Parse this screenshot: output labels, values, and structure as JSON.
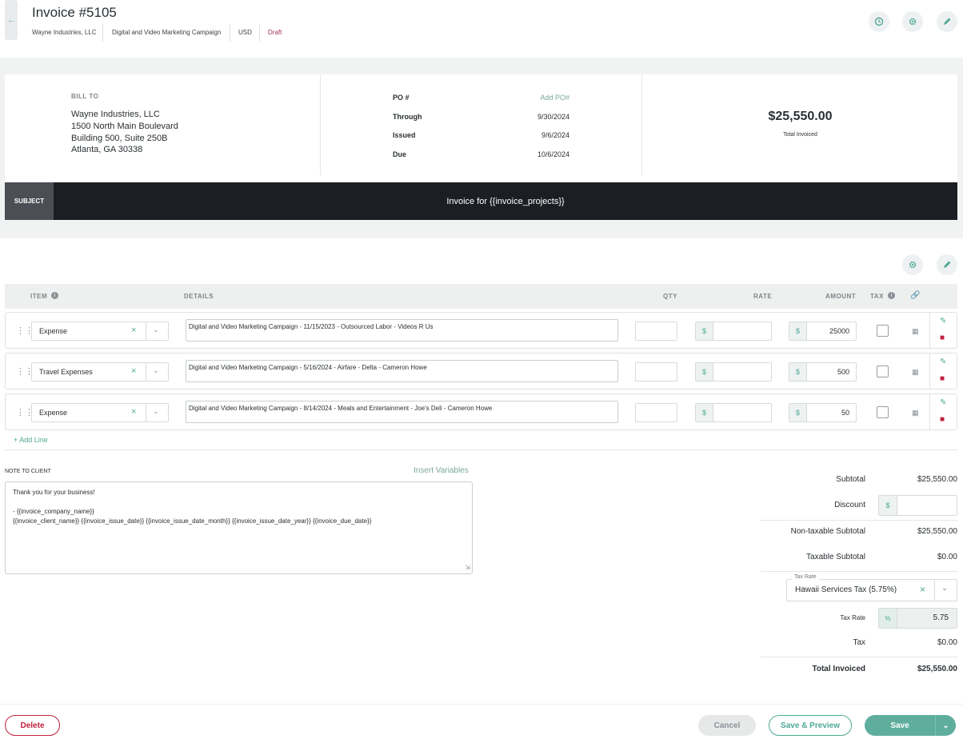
{
  "header": {
    "back_icon": "arrow-left-icon",
    "title": "Invoice #5105",
    "client": "Wayne Industries, LLC",
    "project": "Digital and Video Marketing Campaign",
    "currency": "USD",
    "status": "Draft",
    "status_color": "#a0344c",
    "accent_color": "#4fa896"
  },
  "bill_to": {
    "label": "BILL TO",
    "name": "Wayne Industries, LLC",
    "address1": "1500 North Main Boulevard",
    "address2": "Building 500, Suite 250B",
    "city": "Atlanta, GA 30338"
  },
  "po": {
    "po_label": "PO #",
    "po_placeholder": "Add PO#",
    "through_label": "Through",
    "through_value": "9/30/2024",
    "issued_label": "Issued",
    "issued_value": "9/6/2024",
    "due_label": "Due",
    "due_value": "10/6/2024"
  },
  "summary": {
    "total": "$25,550.00",
    "total_label": "Total Invoiced"
  },
  "subject": {
    "label": "SUBJECT",
    "text": "Invoice for {{invoice_projects}}"
  },
  "table": {
    "headers": {
      "item": "ITEM",
      "details": "DETAILS",
      "qty": "QTY",
      "rate": "RATE",
      "amount": "AMOUNT",
      "tax": "TAX"
    },
    "rows": [
      {
        "item": "Expense",
        "details": "Digital and Video Marketing Campaign - 11/15/2023 - Outsourced Labor - Videos R Us",
        "qty": "",
        "rate": "",
        "amount": "25000",
        "currency_symbol": "$"
      },
      {
        "item": "Travel Expenses",
        "details": "Digital and Video Marketing Campaign - 5/16/2024 - Airfare - Delta - Cameron Howe",
        "qty": "",
        "rate": "",
        "amount": "500",
        "currency_symbol": "$"
      },
      {
        "item": "Expense",
        "details": "Digital and Video Marketing Campaign - 8/14/2024 - Meals and Entertainment - Joe's Deli - Cameron Howe",
        "qty": "",
        "rate": "",
        "amount": "50",
        "currency_symbol": "$"
      }
    ],
    "add_line": "+ Add Line"
  },
  "note": {
    "label": "NOTE TO CLIENT",
    "insert_variables": "Insert Variables",
    "line1": "Thank you for your business!",
    "line2": "- {{invoice_company_name}}",
    "line3": "{{invoice_client_name}} {{invoice_issue_date}} {{invoice_issue_date_month}} {{invoice_issue_date_year}} {{invoice_due_date}}"
  },
  "totals": {
    "subtotal_label": "Subtotal",
    "subtotal": "$25,550.00",
    "discount_label": "Discount",
    "discount_currency": "$",
    "discount_value": "",
    "nontaxable_label": "Non-taxable Subtotal",
    "nontaxable": "$25,550.00",
    "taxable_label": "Taxable Subtotal",
    "taxable": "$0.00",
    "tax_rate_legend": "Tax Rate",
    "tax_rate_selected": "Hawaii Services Tax (5.75%)",
    "tax_rate_label": "Tax Rate",
    "tax_rate_pct_symbol": "%",
    "tax_rate_value": "5.75",
    "tax_label": "Tax",
    "tax": "$0.00",
    "total_label": "Total Invoiced",
    "total": "$25,550.00"
  },
  "footer": {
    "delete": "Delete",
    "cancel": "Cancel",
    "save_preview": "Save & Preview",
    "save": "Save"
  }
}
